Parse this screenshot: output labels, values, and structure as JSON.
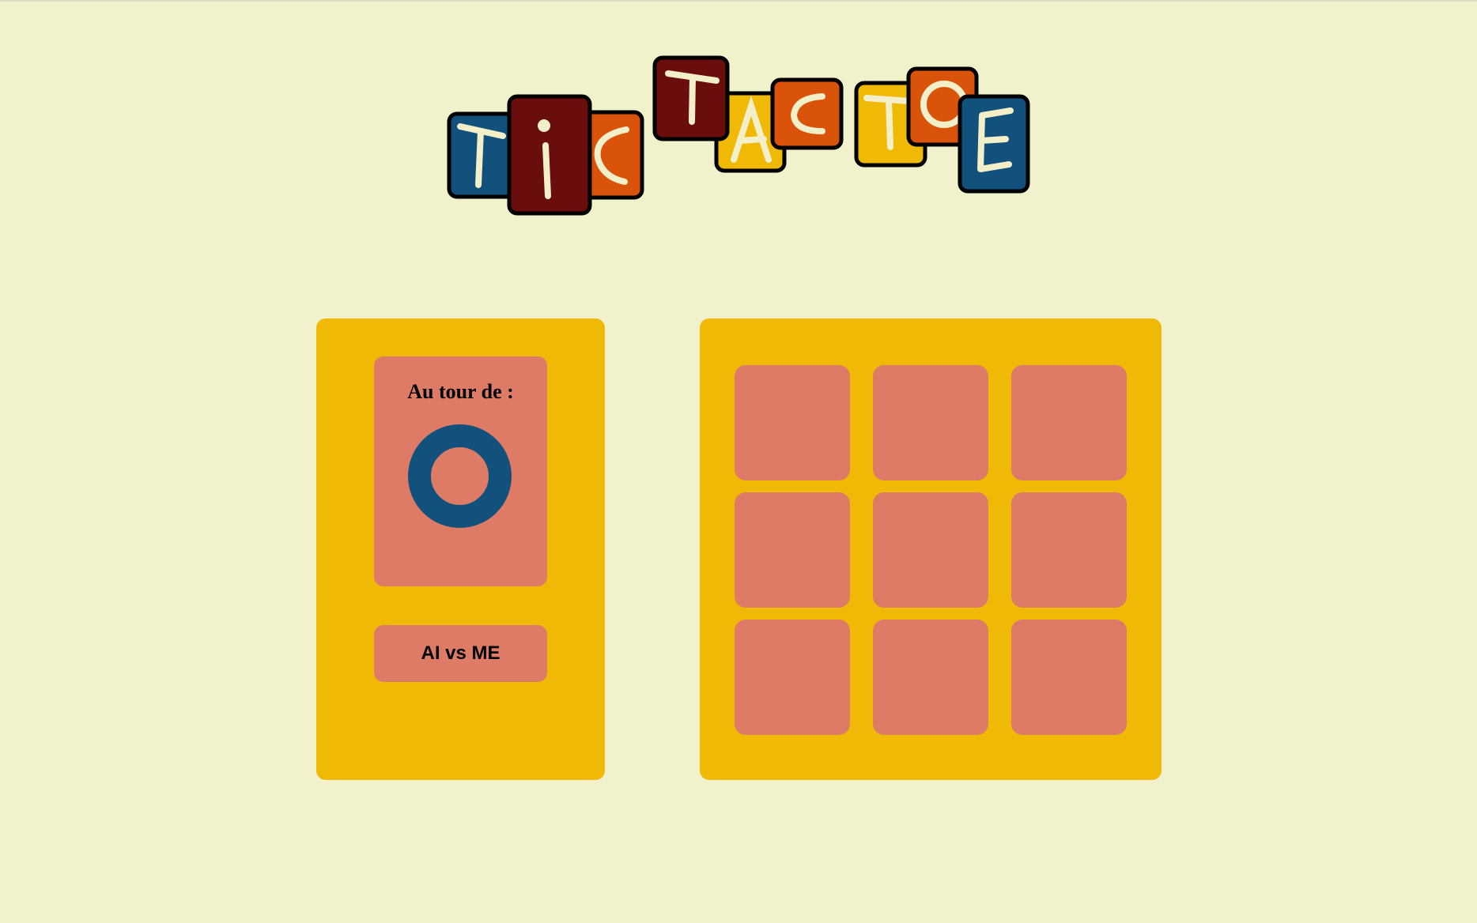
{
  "title": {
    "letters": [
      "T",
      "i",
      "C",
      "T",
      "A",
      "C",
      "T",
      "O",
      "E"
    ]
  },
  "status": {
    "label": "Au tour de :",
    "current_player_symbol": "O"
  },
  "mode_button": {
    "label": "AI vs ME"
  },
  "board": {
    "cells": [
      "",
      "",
      "",
      "",
      "",
      "",
      "",
      "",
      ""
    ]
  },
  "colors": {
    "background": "#f1f2cb",
    "panel": "#f0b906",
    "card": "#dd7b66",
    "player_o": "#12517b",
    "tile_blue": "#12517b",
    "tile_maroon": "#6a0d0d",
    "tile_orange": "#d9530a",
    "tile_yellow": "#f0b906",
    "tile_letter": "#f3efc8"
  }
}
